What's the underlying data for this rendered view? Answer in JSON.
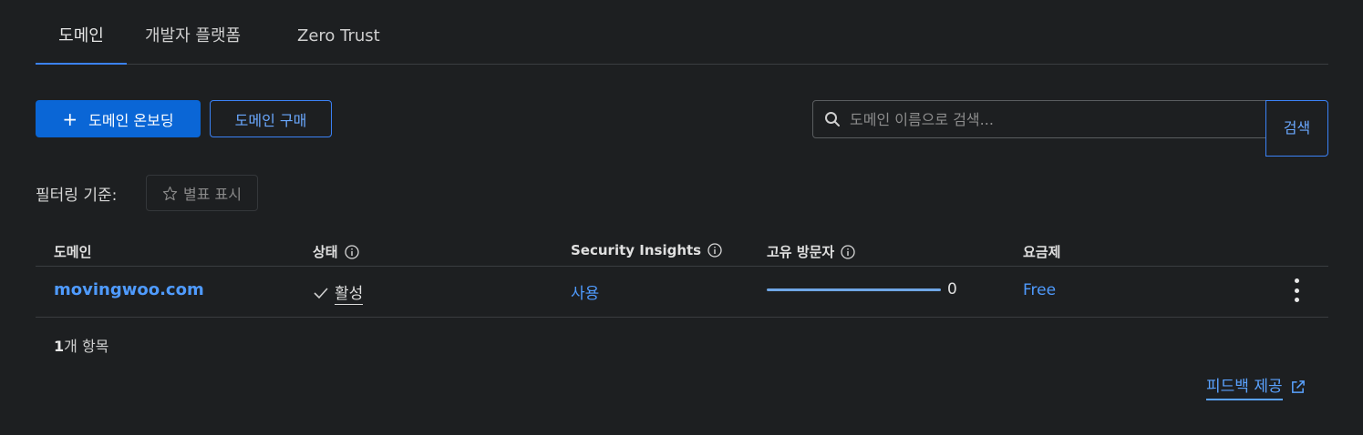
{
  "tabs": [
    {
      "label": "도메인",
      "active": true
    },
    {
      "label": "개발자 플랫폼",
      "active": false
    },
    {
      "label": "Zero Trust",
      "active": false
    }
  ],
  "toolbar": {
    "onboard_label": "도메인 온보딩",
    "buy_label": "도메인 구매"
  },
  "search": {
    "placeholder": "도메인 이름으로 검색...",
    "button_label": "검색"
  },
  "filter": {
    "label": "필터링 기준:",
    "starred_label": "별표 표시"
  },
  "table": {
    "headers": {
      "domain": "도메인",
      "status": "상태",
      "insights": "Security Insights",
      "visitors": "고유 방문자",
      "plan": "요금제"
    },
    "rows": [
      {
        "domain": "movingwoo.com",
        "status": "활성",
        "insights": "사용",
        "unique_visitors": "0",
        "plan": "Free"
      }
    ]
  },
  "footer": {
    "count_number": "1",
    "count_suffix": "개 항목",
    "feedback_label": "피드백 제공"
  },
  "colors": {
    "background": "#1d1f21",
    "accent": "#0a66d6",
    "link": "#4f9bff"
  }
}
